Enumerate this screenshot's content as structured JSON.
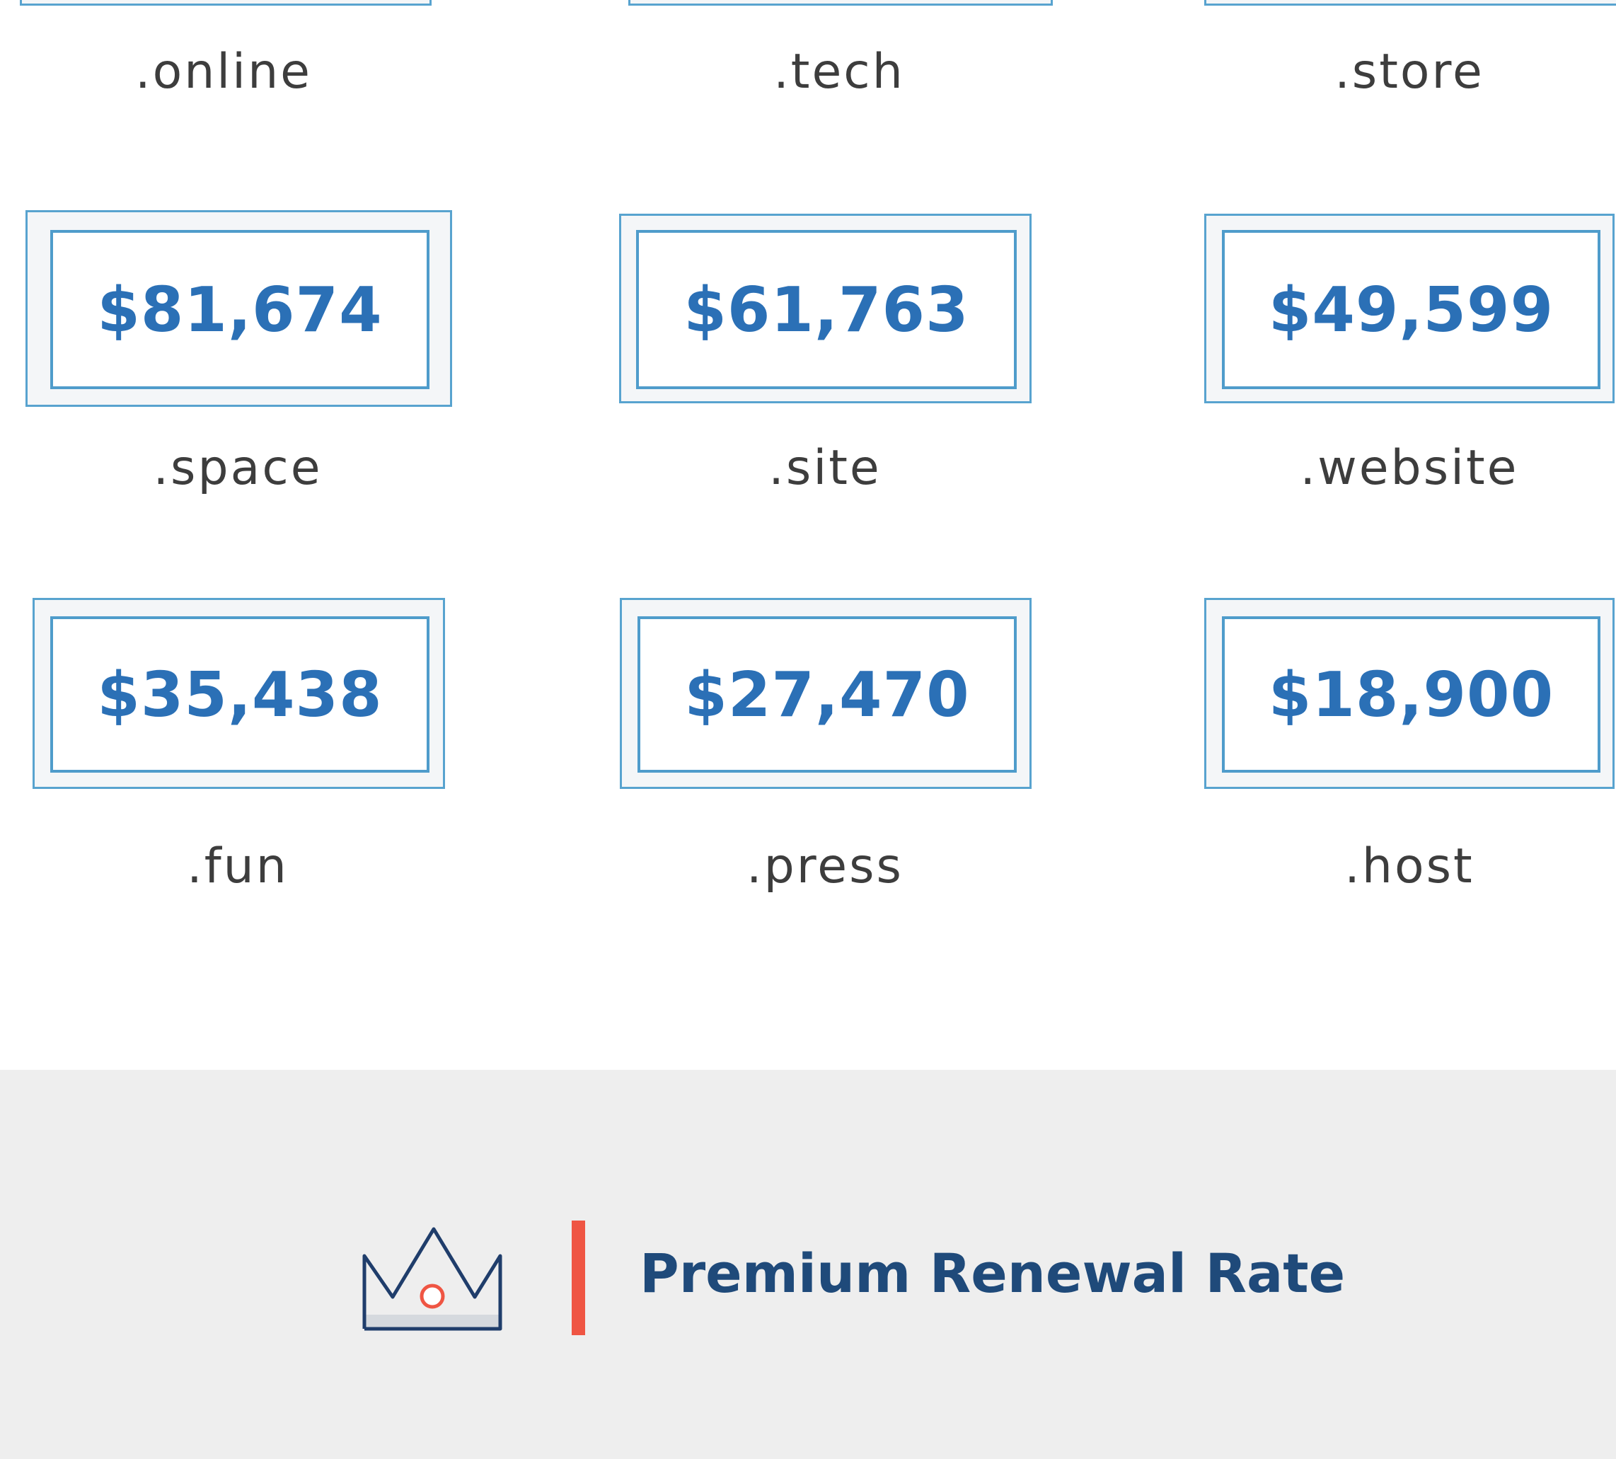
{
  "top_row": [
    {
      "tld": ".online"
    },
    {
      "tld": ".tech"
    },
    {
      "tld": ".store"
    }
  ],
  "grid": [
    {
      "price": "$81,674",
      "tld": ".space"
    },
    {
      "price": "$61,763",
      "tld": ".site"
    },
    {
      "price": "$49,599",
      "tld": ".website"
    },
    {
      "price": "$35,438",
      "tld": ".fun"
    },
    {
      "price": "$27,470",
      "tld": ".press"
    },
    {
      "price": "$18,900",
      "tld": ".host"
    }
  ],
  "footer": {
    "title": "Premium Renewal Rate",
    "icon": "crown-icon"
  },
  "colors": {
    "price_text": "#2b70b6",
    "box_border": "#58a3cf",
    "tld_text": "#3d3d3d",
    "footer_bg": "#eeeeee",
    "footer_title": "#1f4a7a",
    "accent": "#ef5543"
  }
}
